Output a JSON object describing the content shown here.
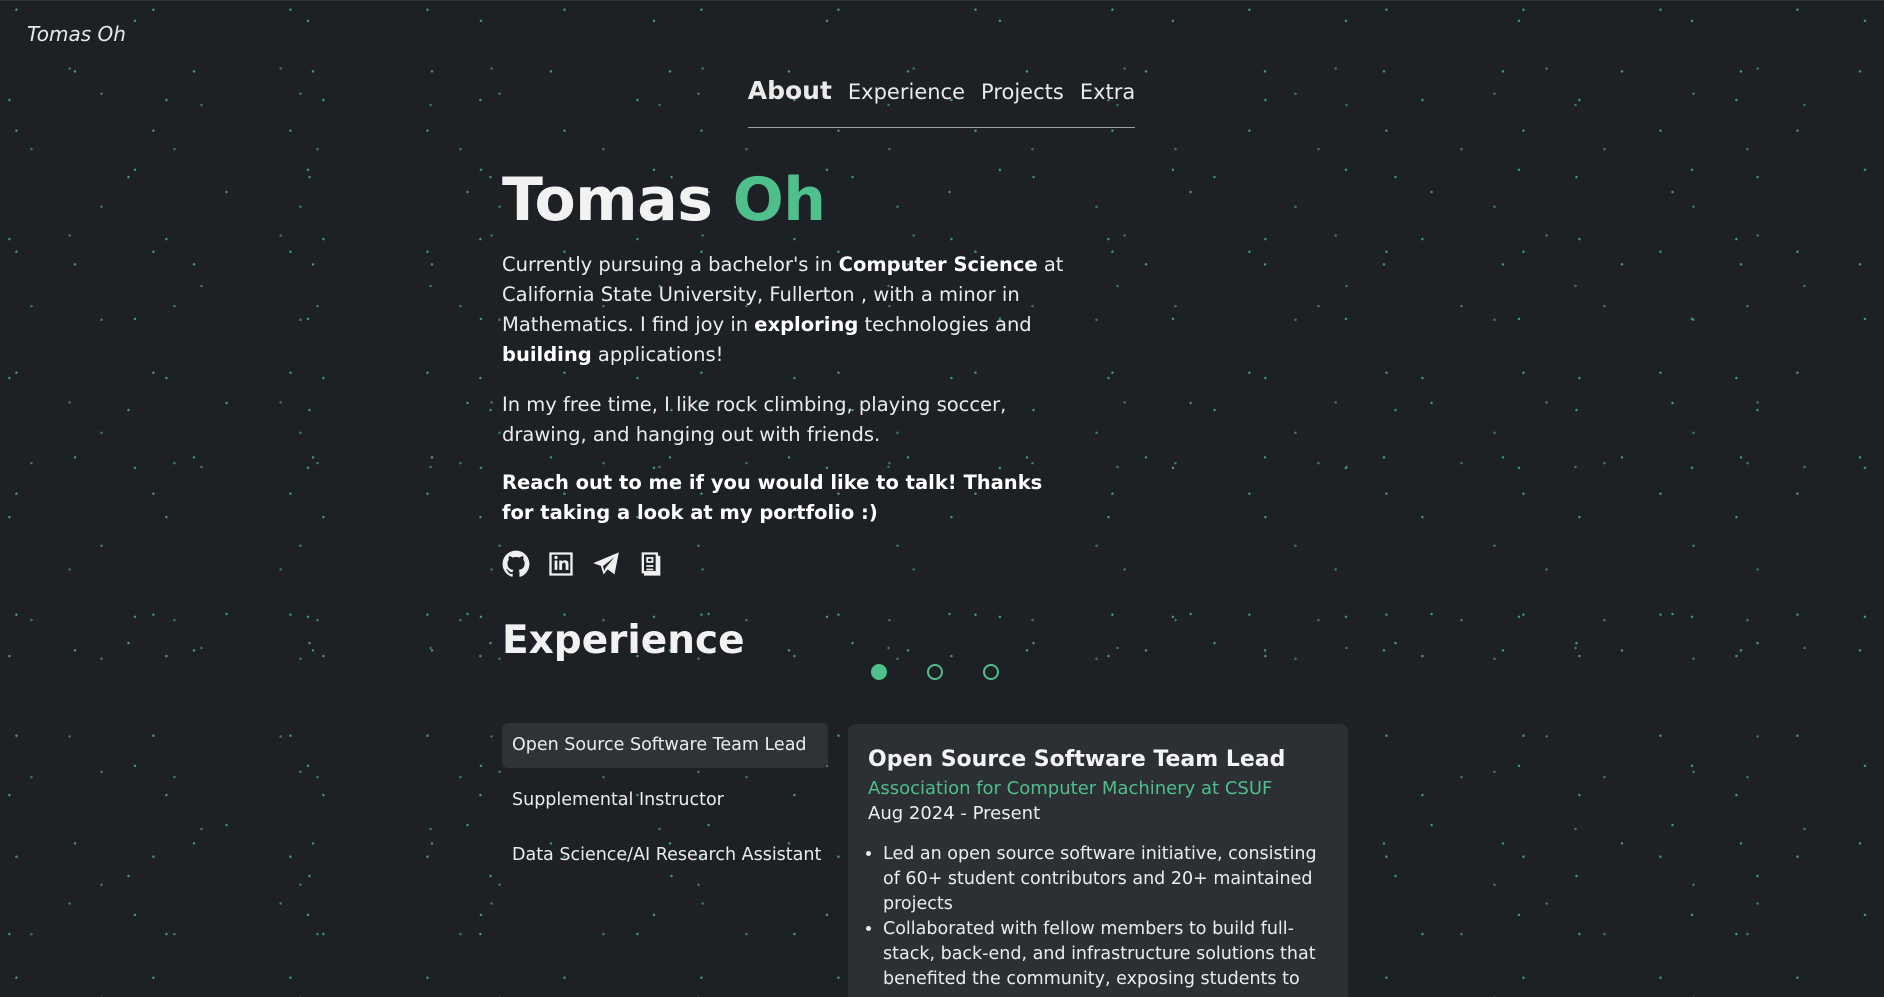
{
  "brand": "Tomas Oh",
  "nav": {
    "items": [
      {
        "label": "About",
        "active": true
      },
      {
        "label": "Experience",
        "active": false
      },
      {
        "label": "Projects",
        "active": false
      },
      {
        "label": "Extra",
        "active": false
      }
    ]
  },
  "hero": {
    "first_name": "Tomas",
    "last_name": "Oh",
    "p1_a": "Currently pursuing a bachelor's in ",
    "p1_b": "Computer Science",
    "p1_c": " at California State University, Fullerton , with a minor in Mathematics. I find joy in ",
    "p1_d": "exploring",
    "p1_e": " technologies and ",
    "p1_f": "building",
    "p1_g": " applications!",
    "p2": "In my free time, I like rock climbing, playing soccer, drawing, and hanging out with friends.",
    "p3": "Reach out to me if you would like to talk! Thanks for taking a look at my portfolio :)",
    "socials": [
      "github-icon",
      "linkedin-icon",
      "telegram-icon",
      "resume-icon"
    ]
  },
  "experience": {
    "title": "Experience",
    "dots": [
      true,
      false,
      false
    ],
    "items": [
      "Open Source Software Team Lead",
      "Supplemental Instructor",
      "Data Science/AI Research Assistant"
    ],
    "card": {
      "title": "Open Source Software Team Lead",
      "org": "Association for Computer Machinery at CSUF",
      "date": "Aug 2024 - Present",
      "bullets": [
        "Led an open source software initiative, consisting of 60+ student contributors and 20+ maintained projects",
        "Collaborated with fellow members to build full-stack, back-end, and infrastructure solutions that benefited the community, exposing students to"
      ]
    }
  },
  "colors": {
    "background": "#1d2024",
    "accent": "#4fbf8c",
    "card": "#2c2f33"
  }
}
